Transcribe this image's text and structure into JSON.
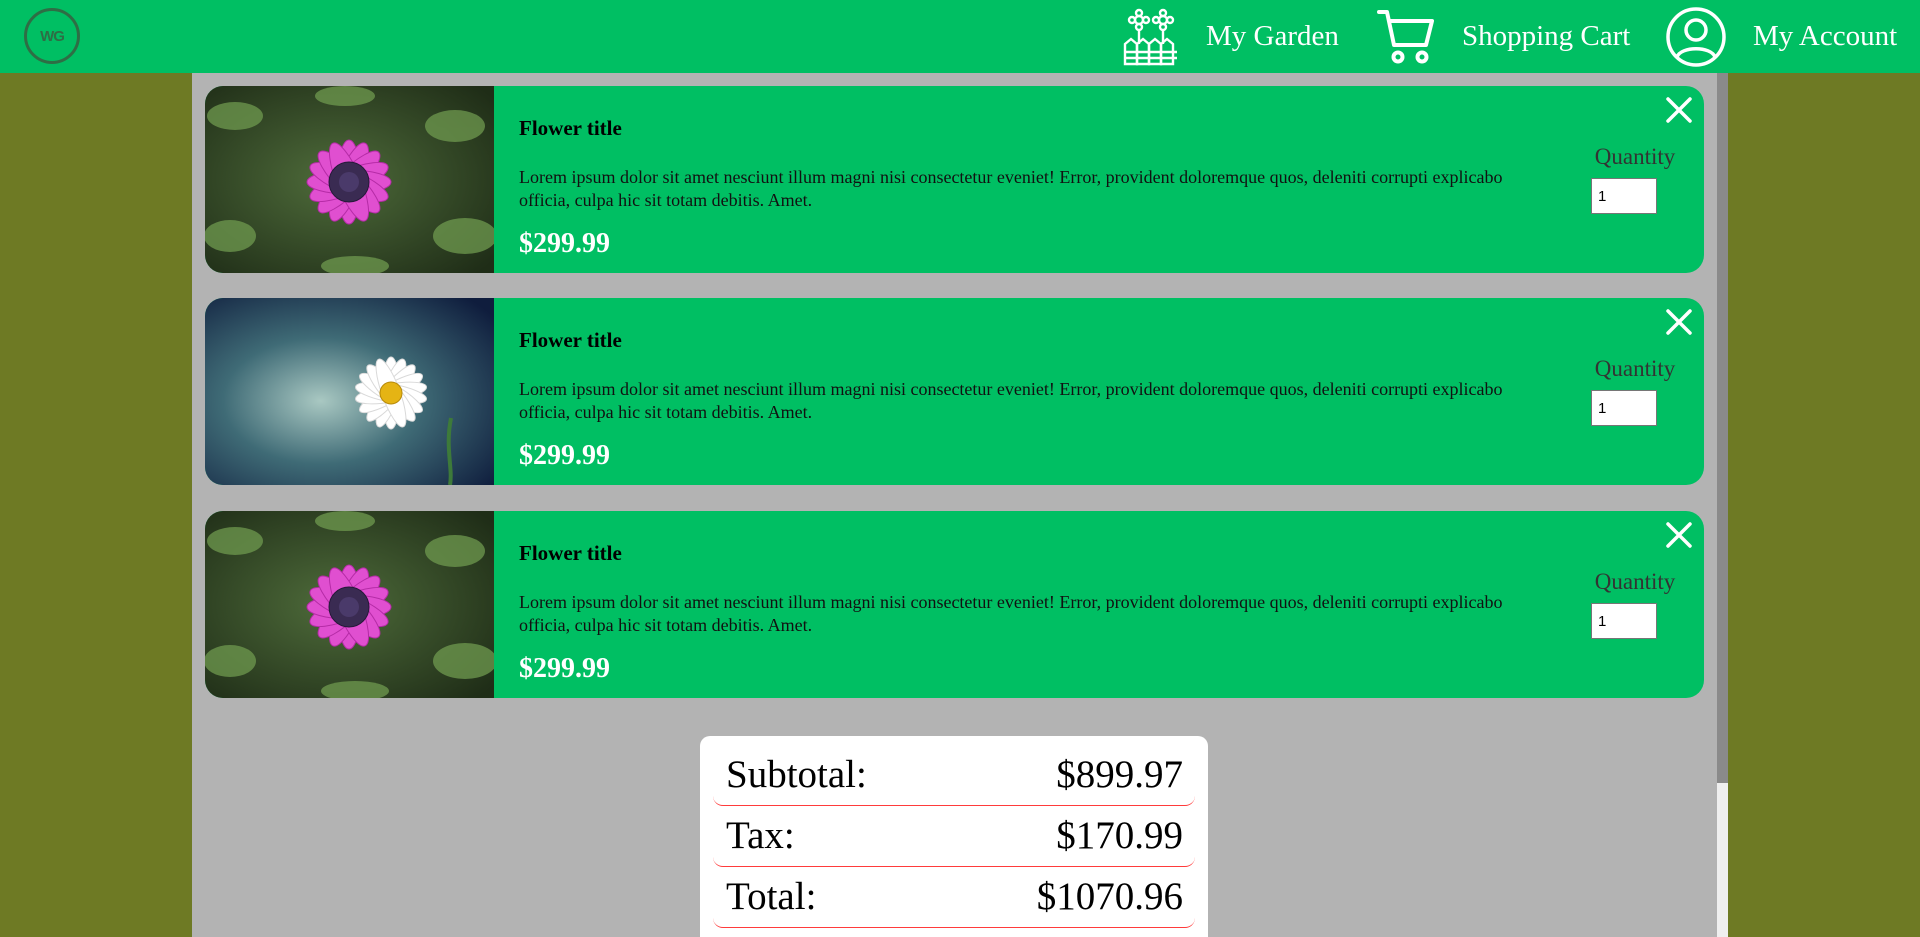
{
  "header": {
    "logo_text": "WG",
    "nav": {
      "garden_label": "My Garden",
      "cart_label": "Shopping Cart",
      "account_label": "My Account"
    }
  },
  "cart": {
    "items": [
      {
        "title": "Flower title",
        "description": "Lorem ipsum dolor sit amet nesciunt illum magni nisi consectetur eveniet! Error, provident doloremque quos, deleniti corrupti explicabo officia, culpa hic sit totam debitis. Amet.",
        "price": "$299.99",
        "quantity_label": "Quantity",
        "quantity": "1",
        "image": "pink-daisy"
      },
      {
        "title": "Flower title",
        "description": "Lorem ipsum dolor sit amet nesciunt illum magni nisi consectetur eveniet! Error, provident doloremque quos, deleniti corrupti explicabo officia, culpa hic sit totam debitis. Amet.",
        "price": "$299.99",
        "quantity_label": "Quantity",
        "quantity": "1",
        "image": "white-daisy"
      },
      {
        "title": "Flower title",
        "description": "Lorem ipsum dolor sit amet nesciunt illum magni nisi consectetur eveniet! Error, provident doloremque quos, deleniti corrupti explicabo officia, culpa hic sit totam debitis. Amet.",
        "price": "$299.99",
        "quantity_label": "Quantity",
        "quantity": "1",
        "image": "pink-daisy"
      }
    ]
  },
  "summary": {
    "subtotal_label": "Subtotal:",
    "subtotal_value": "$899.97",
    "tax_label": "Tax:",
    "tax_value": "$170.99",
    "total_label": "Total:",
    "total_value": "$1070.96"
  },
  "colors": {
    "header_green": "#00bf63",
    "page_olive": "#6e7a24",
    "panel_gray": "#b3b3b3",
    "divider_red": "#ff3b3b"
  }
}
